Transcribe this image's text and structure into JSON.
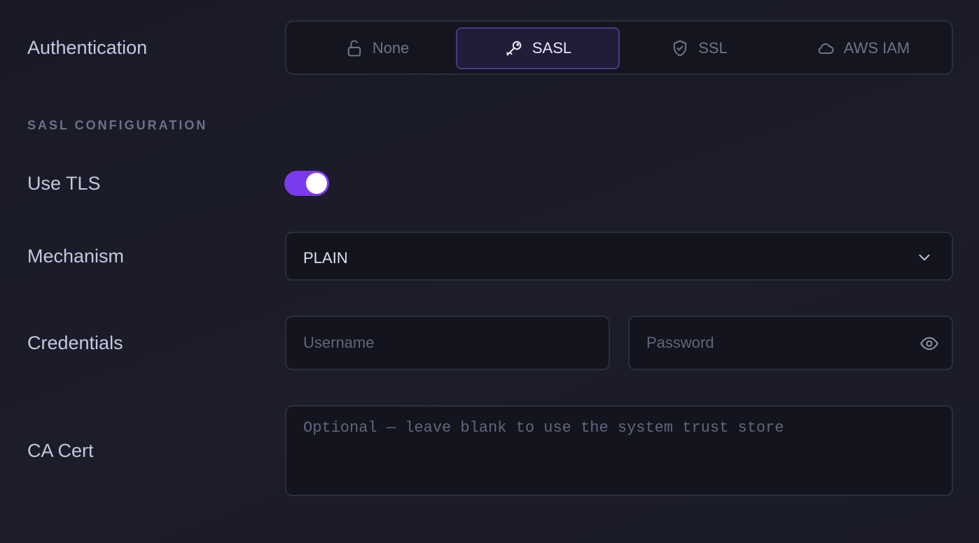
{
  "authentication": {
    "label": "Authentication",
    "options": [
      {
        "label": "None",
        "icon": "unlock-icon"
      },
      {
        "label": "SASL",
        "icon": "key-icon"
      },
      {
        "label": "SSL",
        "icon": "shield-icon"
      },
      {
        "label": "AWS IAM",
        "icon": "cloud-icon"
      }
    ],
    "selected": "SASL"
  },
  "section_title": "SASL CONFIGURATION",
  "use_tls": {
    "label": "Use TLS",
    "enabled": true
  },
  "mechanism": {
    "label": "Mechanism",
    "value": "PLAIN"
  },
  "credentials": {
    "label": "Credentials",
    "username_placeholder": "Username",
    "password_placeholder": "Password"
  },
  "ca_cert": {
    "label": "CA Cert",
    "placeholder": "Optional — leave blank to use the system trust store"
  },
  "colors": {
    "accent": "#7c3aed",
    "background": "#1a1b26"
  }
}
